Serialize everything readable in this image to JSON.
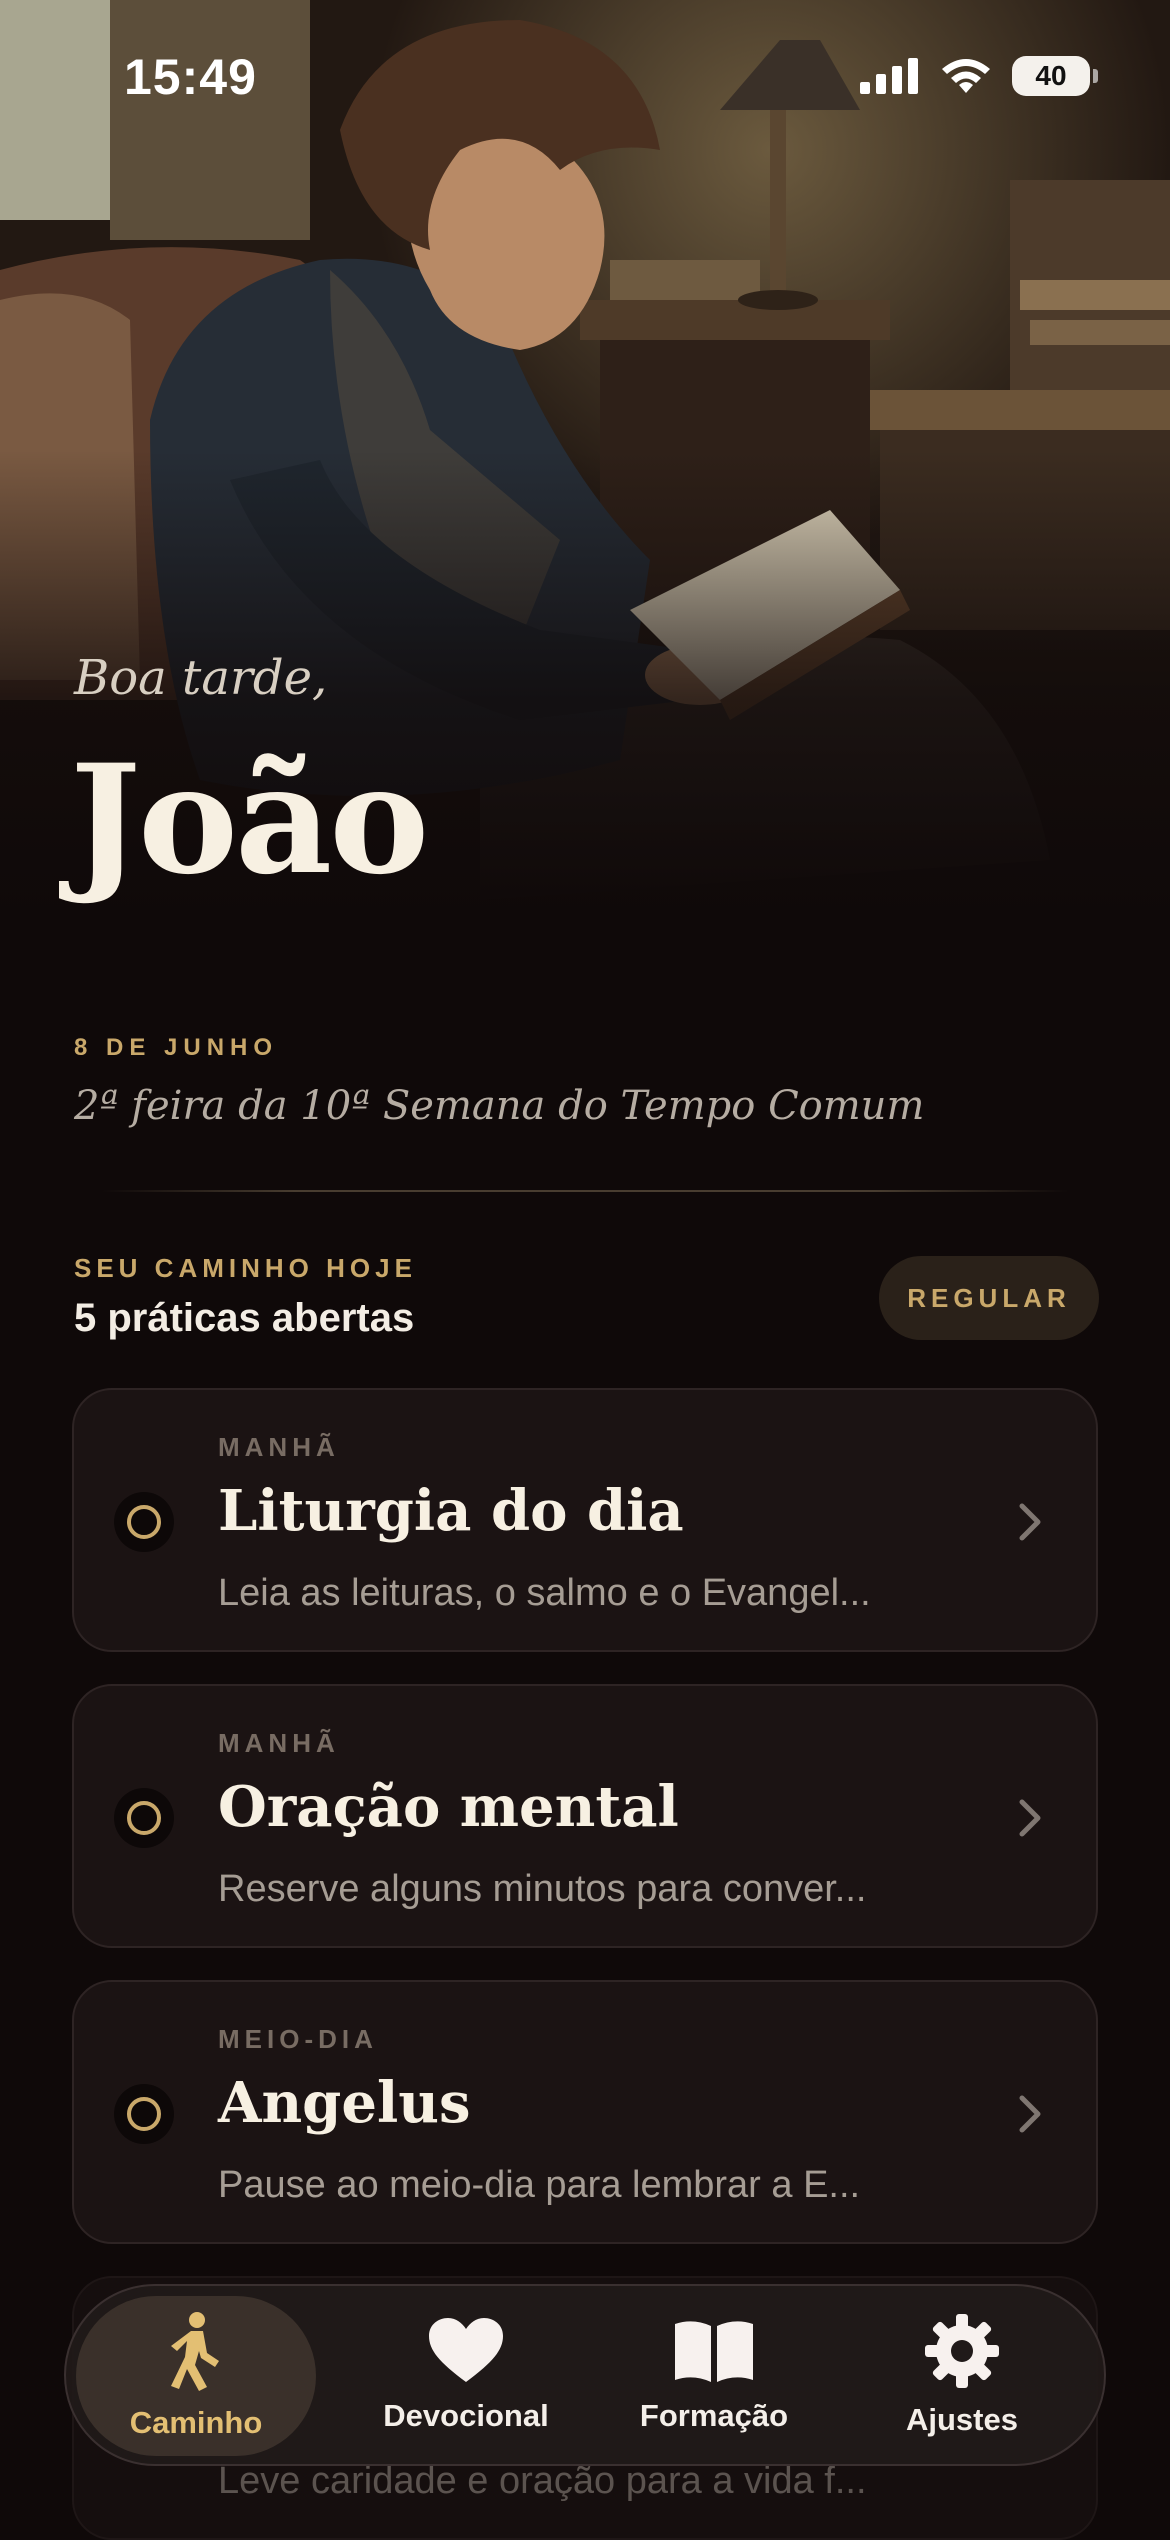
{
  "status_bar": {
    "time": "15:49",
    "battery": "40"
  },
  "hero": {
    "greeting": "Boa tarde,",
    "name": "João"
  },
  "date": {
    "label": "8 DE JUNHO",
    "liturgical": "2ª feira da 10ª Semana do Tempo Comum"
  },
  "today": {
    "section_label": "SEU CAMINHO HOJE",
    "summary": "5 práticas abertas",
    "mode_button": "REGULAR"
  },
  "practices": [
    {
      "time": "MANHÃ",
      "title": "Liturgia do dia",
      "description": "Leia as leituras, o salmo e o Evangel..."
    },
    {
      "time": "MANHÃ",
      "title": "Oração mental",
      "description": "Reserve alguns minutos para conver..."
    },
    {
      "time": "MEIO-DIA",
      "title": "Angelus",
      "description": "Pause ao meio-dia para lembrar a E..."
    },
    {
      "time": "",
      "title": "",
      "description": "Leve caridade e oração para a vida f..."
    }
  ],
  "nav": {
    "items": [
      {
        "label": "Caminho",
        "icon": "walking-icon",
        "active": true
      },
      {
        "label": "Devocional",
        "icon": "heart-icon",
        "active": false
      },
      {
        "label": "Formação",
        "icon": "book-icon",
        "active": false
      },
      {
        "label": "Ajustes",
        "icon": "gear-icon",
        "active": false
      }
    ]
  },
  "colors": {
    "accent": "#c9a86a",
    "background": "#0f0909",
    "card": "#1b1313"
  }
}
